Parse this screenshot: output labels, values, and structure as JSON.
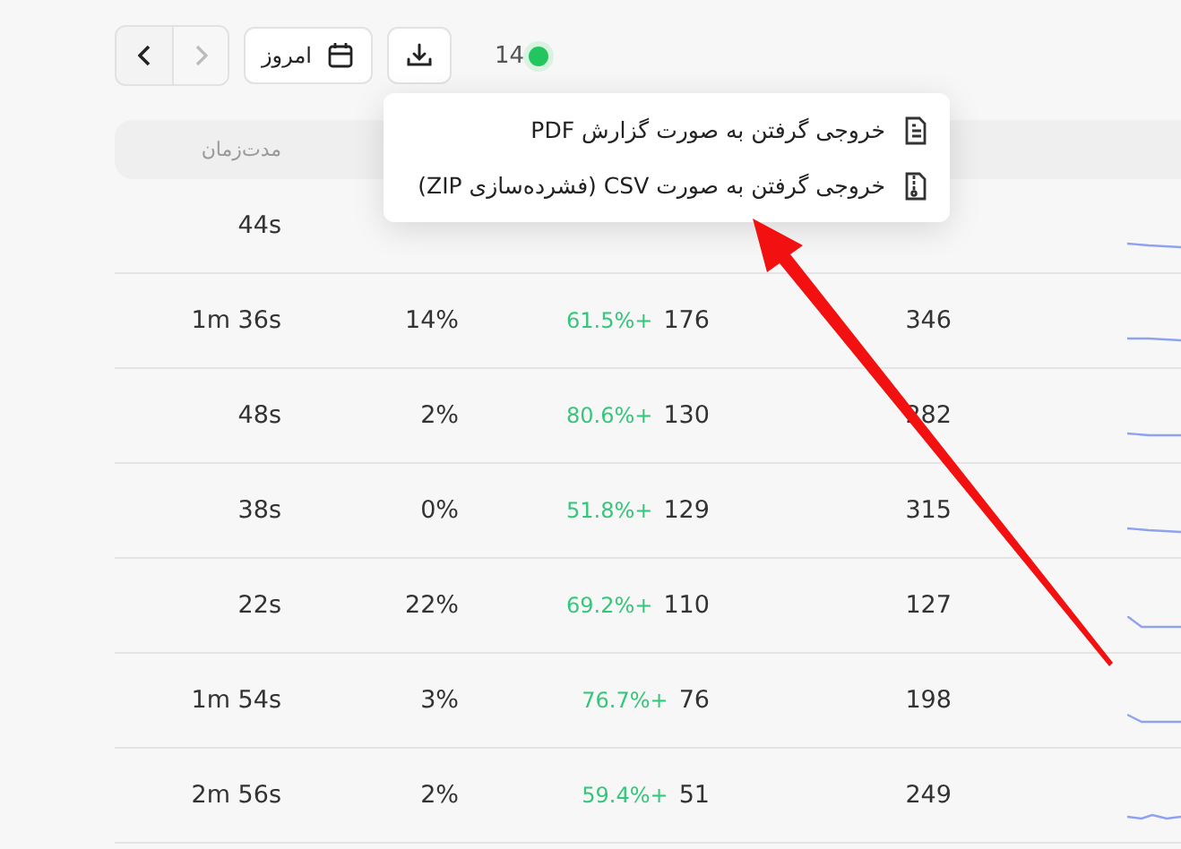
{
  "toolbar": {
    "date_button": {
      "label": "امروز"
    },
    "live_count": {
      "count": "14",
      "color": "#22c55e"
    }
  },
  "export_menu": {
    "items": [
      {
        "label": "خروجی گرفتن به صورت گزارش PDF",
        "kind": "pdf"
      },
      {
        "label": "خروجی گرفتن به صورت CSV (فشرده‌سازی ZIP)",
        "kind": "zip"
      }
    ]
  },
  "table": {
    "columns": [
      {
        "label": "مدت‌زمان"
      }
    ],
    "rows": [
      {
        "duration": "44s"
      },
      {
        "duration": "1m 36s",
        "rate": "14%",
        "change": "61.5%+",
        "count": "176",
        "total": "346"
      },
      {
        "duration": "48s",
        "rate": "2%",
        "change": "80.6%+",
        "count": "130",
        "total": "282"
      },
      {
        "duration": "38s",
        "rate": "0%",
        "change": "51.8%+",
        "count": "129",
        "total": "315"
      },
      {
        "duration": "22s",
        "rate": "22%",
        "change": "69.2%+",
        "count": "110",
        "total": "127"
      },
      {
        "duration": "1m 54s",
        "rate": "3%",
        "change": "76.7%+",
        "count": "76",
        "total": "198"
      },
      {
        "duration": "2m 56s",
        "rate": "2%",
        "change": "59.4%+",
        "count": "51",
        "total": "249"
      }
    ]
  }
}
